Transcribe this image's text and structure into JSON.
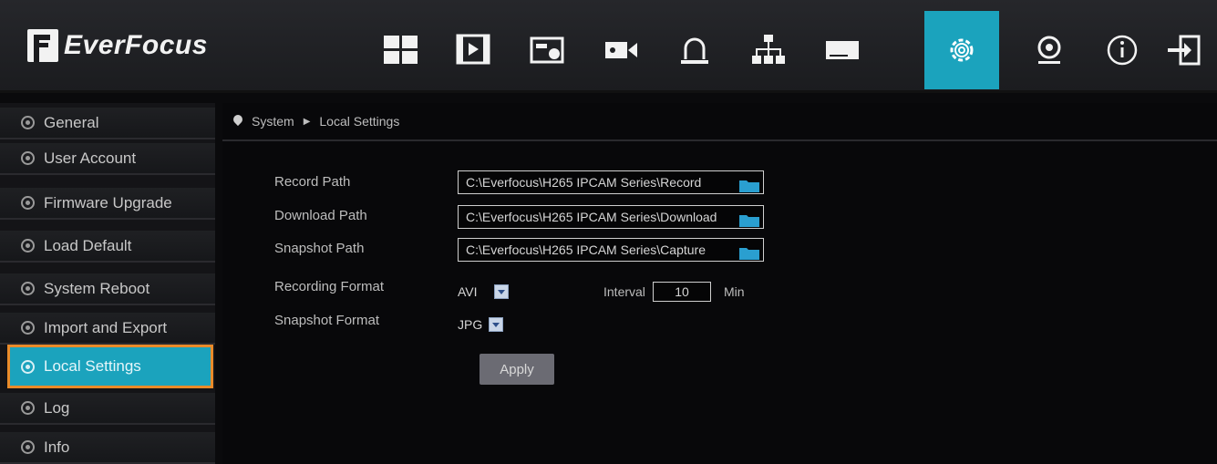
{
  "brand": {
    "name": "EverFocus"
  },
  "nav_icons": [
    {
      "name": "live-view-grid-icon",
      "label": ""
    },
    {
      "name": "playback-icon",
      "label": ""
    },
    {
      "name": "snapshot-icon",
      "label": ""
    },
    {
      "name": "camera-icon",
      "label": ""
    },
    {
      "name": "alarm-icon",
      "label": ""
    },
    {
      "name": "network-icon",
      "label": ""
    },
    {
      "name": "storage-icon",
      "label": ""
    },
    {
      "name": "system-gear-icon",
      "label": "",
      "active": true
    },
    {
      "name": "maintenance-icon",
      "label": ""
    },
    {
      "name": "info-icon",
      "label": ""
    },
    {
      "name": "logout-icon",
      "label": ""
    }
  ],
  "sidebar": {
    "items": [
      {
        "label": "General"
      },
      {
        "label": "User Account"
      },
      {
        "label": "Firmware Upgrade"
      },
      {
        "label": "Load Default"
      },
      {
        "label": "System Reboot"
      },
      {
        "label": "Import and Export"
      },
      {
        "label": "Local Settings",
        "active": true
      },
      {
        "label": "Log"
      },
      {
        "label": "Info"
      }
    ]
  },
  "breadcrumb": {
    "root": "System",
    "current": "Local Settings"
  },
  "form": {
    "record_path": {
      "label": "Record Path",
      "value": "C:\\Everfocus\\H265 IPCAM Series\\Record"
    },
    "download_path": {
      "label": "Download Path",
      "value": "C:\\Everfocus\\H265 IPCAM Series\\Download"
    },
    "snapshot_path": {
      "label": "Snapshot Path",
      "value": "C:\\Everfocus\\H265 IPCAM Series\\Capture"
    },
    "recording_format": {
      "label": "Recording Format",
      "value": "AVI"
    },
    "interval": {
      "label": "Interval",
      "value": "10",
      "unit": "Min"
    },
    "snapshot_format": {
      "label": "Snapshot Format",
      "value": "JPG"
    },
    "apply_label": "Apply"
  },
  "colors": {
    "accent": "#1ba3bd",
    "highlight_border": "#e98b2a",
    "folder": "#2a9fd0"
  }
}
